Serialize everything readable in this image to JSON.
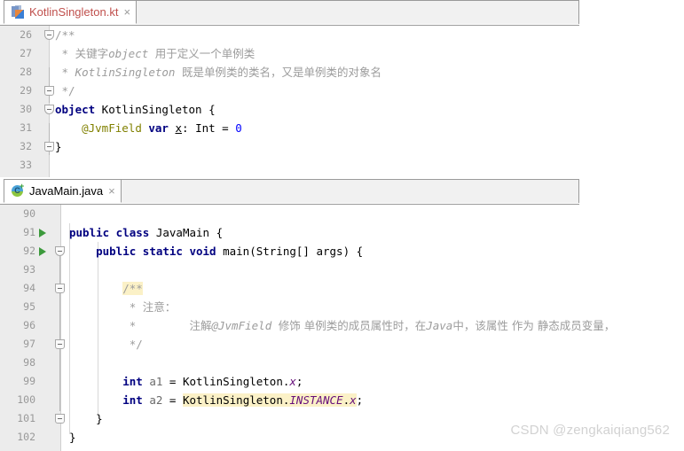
{
  "colors": {
    "keyword": "#000080",
    "comment": "#9c9c9c",
    "annotation": "#808000",
    "number": "#0000ff",
    "field": "#660e7a",
    "highlight": "#fbf1c7",
    "gutter_bg": "#ececec",
    "editor_bg": "#ffffff",
    "run_arrow": "#3c9a3c",
    "kt_tab_title": "#c0504d",
    "watermark": "#d2d2d2"
  },
  "editors": [
    {
      "id": "kotlin-editor",
      "tab": {
        "title": "KotlinSingleton.kt",
        "icon": "kotlin-file-icon",
        "close_label": "×"
      },
      "first_line": 26,
      "lines": [
        {
          "no": 26,
          "fold": "open",
          "segments": [
            {
              "t": "/**",
              "c": "cmt"
            }
          ]
        },
        {
          "no": 27,
          "fold": null,
          "segments": [
            {
              "t": " * ",
              "c": "cmt"
            },
            {
              "t": "关键字",
              "c": "cmt-cn"
            },
            {
              "t": "object",
              "c": "cmt-i"
            },
            {
              "t": " ",
              "c": "cmt"
            },
            {
              "t": "用于定义一个单例类",
              "c": "cmt-cn"
            }
          ]
        },
        {
          "no": 28,
          "fold": null,
          "segments": [
            {
              "t": " * ",
              "c": "cmt"
            },
            {
              "t": "KotlinSingleton",
              "c": "cmt-i"
            },
            {
              "t": " ",
              "c": "cmt"
            },
            {
              "t": "既是单例类的类名，又是单例类的对象名",
              "c": "cmt-cn"
            }
          ]
        },
        {
          "no": 29,
          "fold": "close",
          "segments": [
            {
              "t": " */",
              "c": "cmt"
            }
          ]
        },
        {
          "no": 30,
          "fold": "open",
          "segments": [
            {
              "t": "object",
              "c": "kw"
            },
            {
              "t": " KotlinSingleton {",
              "c": "ident"
            }
          ]
        },
        {
          "no": 31,
          "fold": null,
          "segments": [
            {
              "t": "    ",
              "c": "ident"
            },
            {
              "t": "@JvmField",
              "c": "annot"
            },
            {
              "t": " ",
              "c": "ident"
            },
            {
              "t": "var",
              "c": "kw"
            },
            {
              "t": " ",
              "c": "ident"
            },
            {
              "t": "x",
              "c": "underlined"
            },
            {
              "t": ": Int = ",
              "c": "ident"
            },
            {
              "t": "0",
              "c": "num"
            }
          ]
        },
        {
          "no": 32,
          "fold": "close",
          "segments": [
            {
              "t": "}",
              "c": "ident"
            }
          ]
        },
        {
          "no": 33,
          "fold": null,
          "segments": [
            {
              "t": "",
              "c": "ident"
            }
          ]
        }
      ]
    },
    {
      "id": "java-editor",
      "tab": {
        "title": "JavaMain.java",
        "icon": "java-class-icon",
        "close_label": "×"
      },
      "first_line": 90,
      "lines": [
        {
          "no": 90,
          "fold": null,
          "run": false,
          "segments": [
            {
              "t": "",
              "c": "ident"
            }
          ]
        },
        {
          "no": 91,
          "fold": null,
          "run": true,
          "segments": [
            {
              "t": "public class",
              "c": "kw"
            },
            {
              "t": " JavaMain {",
              "c": "ident"
            }
          ]
        },
        {
          "no": 92,
          "fold": "open",
          "run": true,
          "segments": [
            {
              "t": "    ",
              "c": "ident"
            },
            {
              "t": "public static void",
              "c": "kw"
            },
            {
              "t": " main(String[] args) {",
              "c": "ident"
            }
          ]
        },
        {
          "no": 93,
          "fold": null,
          "run": false,
          "segments": [
            {
              "t": "",
              "c": "ident"
            }
          ]
        },
        {
          "no": 94,
          "fold": "close",
          "run": false,
          "segments": [
            {
              "t": "        ",
              "c": "ident"
            },
            {
              "t": "/**",
              "c": "cmt hl"
            }
          ]
        },
        {
          "no": 95,
          "fold": null,
          "run": false,
          "segments": [
            {
              "t": "         * ",
              "c": "cmt"
            },
            {
              "t": "注意：",
              "c": "cmt-cn"
            }
          ]
        },
        {
          "no": 96,
          "fold": null,
          "run": false,
          "segments": [
            {
              "t": "         *        ",
              "c": "cmt"
            },
            {
              "t": "注解",
              "c": "cmt-cn"
            },
            {
              "t": "@JvmField",
              "c": "cmt-i"
            },
            {
              "t": " ",
              "c": "cmt"
            },
            {
              "t": "修饰 单例类的成员属性时，在",
              "c": "cmt-cn"
            },
            {
              "t": "Java",
              "c": "cmt-i"
            },
            {
              "t": "中，该属性 作为 静态成员变量，",
              "c": "cmt-cn"
            }
          ]
        },
        {
          "no": 97,
          "fold": "close",
          "run": false,
          "segments": [
            {
              "t": "         */",
              "c": "cmt"
            }
          ]
        },
        {
          "no": 98,
          "fold": null,
          "run": false,
          "segments": [
            {
              "t": "",
              "c": "ident"
            }
          ]
        },
        {
          "no": 99,
          "fold": null,
          "run": false,
          "segments": [
            {
              "t": "        ",
              "c": "ident"
            },
            {
              "t": "int",
              "c": "kw"
            },
            {
              "t": " ",
              "c": "ident"
            },
            {
              "t": "a1",
              "c": "local"
            },
            {
              "t": " = KotlinSingleton.",
              "c": "ident"
            },
            {
              "t": "x",
              "c": "field"
            },
            {
              "t": ";",
              "c": "ident"
            }
          ]
        },
        {
          "no": 100,
          "fold": null,
          "run": false,
          "segments": [
            {
              "t": "        ",
              "c": "ident"
            },
            {
              "t": "int",
              "c": "kw"
            },
            {
              "t": " ",
              "c": "ident"
            },
            {
              "t": "a2",
              "c": "local"
            },
            {
              "t": " = ",
              "c": "ident"
            },
            {
              "t": "KotlinSingleton.",
              "c": "ident hl"
            },
            {
              "t": "INSTANCE",
              "c": "field hl"
            },
            {
              "t": ".",
              "c": "ident hl"
            },
            {
              "t": "x",
              "c": "field hl"
            },
            {
              "t": ";",
              "c": "ident"
            }
          ]
        },
        {
          "no": 101,
          "fold": "close",
          "run": false,
          "segments": [
            {
              "t": "    }",
              "c": "ident"
            }
          ]
        },
        {
          "no": 102,
          "fold": null,
          "run": false,
          "segments": [
            {
              "t": "}",
              "c": "ident"
            }
          ]
        }
      ]
    }
  ],
  "watermark": "CSDN @zengkaiqiang562"
}
